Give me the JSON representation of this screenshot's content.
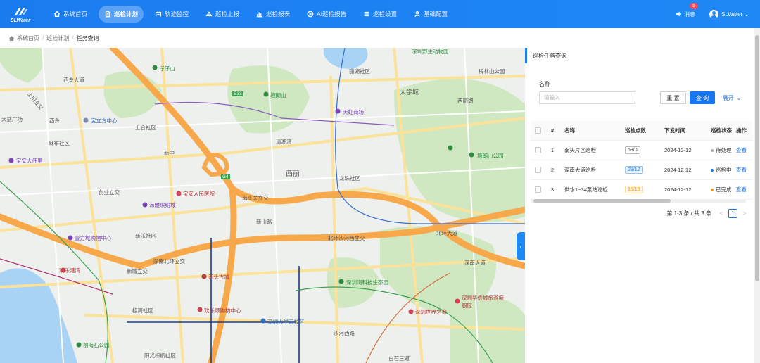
{
  "app": {
    "logo_text": "SLWater"
  },
  "nav": [
    {
      "label": "系统首页",
      "icon": "home-icon",
      "active": false
    },
    {
      "label": "巡检计划",
      "icon": "document-icon",
      "active": true
    },
    {
      "label": "轨迹监控",
      "icon": "track-icon",
      "active": false
    },
    {
      "label": "巡检上报",
      "icon": "report-icon",
      "active": false
    },
    {
      "label": "巡检报表",
      "icon": "chart-icon",
      "active": false
    },
    {
      "label": "AI巡检报告",
      "icon": "ai-icon",
      "active": false
    },
    {
      "label": "巡检设置",
      "icon": "settings-icon",
      "active": false
    },
    {
      "label": "基础配置",
      "icon": "user-config-icon",
      "active": false
    }
  ],
  "header": {
    "message_label": "消息",
    "message_count": "5",
    "user_name": "SLWater"
  },
  "breadcrumb": {
    "home": "系统首页",
    "level2": "巡检计划",
    "current": "任务查询"
  },
  "map": {
    "labels": [
      "西乡大道",
      "上川立交",
      "大益广场",
      "西乡",
      "宝立方中心",
      "上合社区",
      "麻布社区",
      "新中",
      "宝安大仟里",
      "创业立交",
      "宝安人民医院",
      "海雅缤纷城",
      "壹方城购物中心",
      "新乐社区",
      "欢乐港湾",
      "新城立交",
      "深南北环立交",
      "南头古城",
      "欢乐颂购物中心",
      "桂湾社区",
      "前海石公园",
      "阳光棕榈社区",
      "仔仔山",
      "清湖湾",
      "西丽",
      "南头关立交",
      "新山路",
      "北环沙河西立交",
      "深圳湾科技生态园",
      "深圳大学南校区",
      "沙河西路",
      "塘朗山",
      "天虹商场",
      "大学城",
      "龙珠社区",
      "深圳野生动物园",
      "深圳华侨城旅游度假区",
      "深圳世界之窗",
      "梅林山公园",
      "塘朗山公园",
      "北环大道",
      "深南大道",
      "白石三道",
      "丽湖社区",
      "西丽湖",
      "G4",
      "S33"
    ]
  },
  "panel": {
    "title": "巡检任务查询",
    "form": {
      "name_label": "名称",
      "name_placeholder": "请输入",
      "reset_label": "重 置",
      "query_label": "查 询",
      "expand_label": "展开"
    },
    "table": {
      "columns": [
        "#",
        "名称",
        "巡检点数",
        "下发时间",
        "巡检状态",
        "操作"
      ],
      "rows": [
        {
          "no": "1",
          "name": "南头片区巡检",
          "points": "59/0",
          "time": "2024-12-12",
          "status": "待处理",
          "status_color": "#aaaaaa",
          "points_style": "grey",
          "action": "查看"
        },
        {
          "no": "2",
          "name": "深南大道巡检",
          "points": "29/12",
          "time": "2024-12-12",
          "status": "巡检中",
          "status_color": "#1677f0",
          "points_style": "blue",
          "action": "查看"
        },
        {
          "no": "3",
          "name": "供水1~3#泵站巡检",
          "points": "15/15",
          "time": "2024-12-12",
          "status": "已完成",
          "status_color": "#f0a020",
          "points_style": "orange",
          "action": "查看"
        }
      ]
    },
    "pager": {
      "summary": "第 1-3 条 / 共 3 条",
      "current_page": "1"
    }
  },
  "colors": {
    "primary": "#1e88f5",
    "badge": "#f5475a",
    "road_major": "#f7a84a",
    "road_minor": "#fbe29a",
    "green_area": "#cfe8c2",
    "water": "#a9d3f5"
  }
}
